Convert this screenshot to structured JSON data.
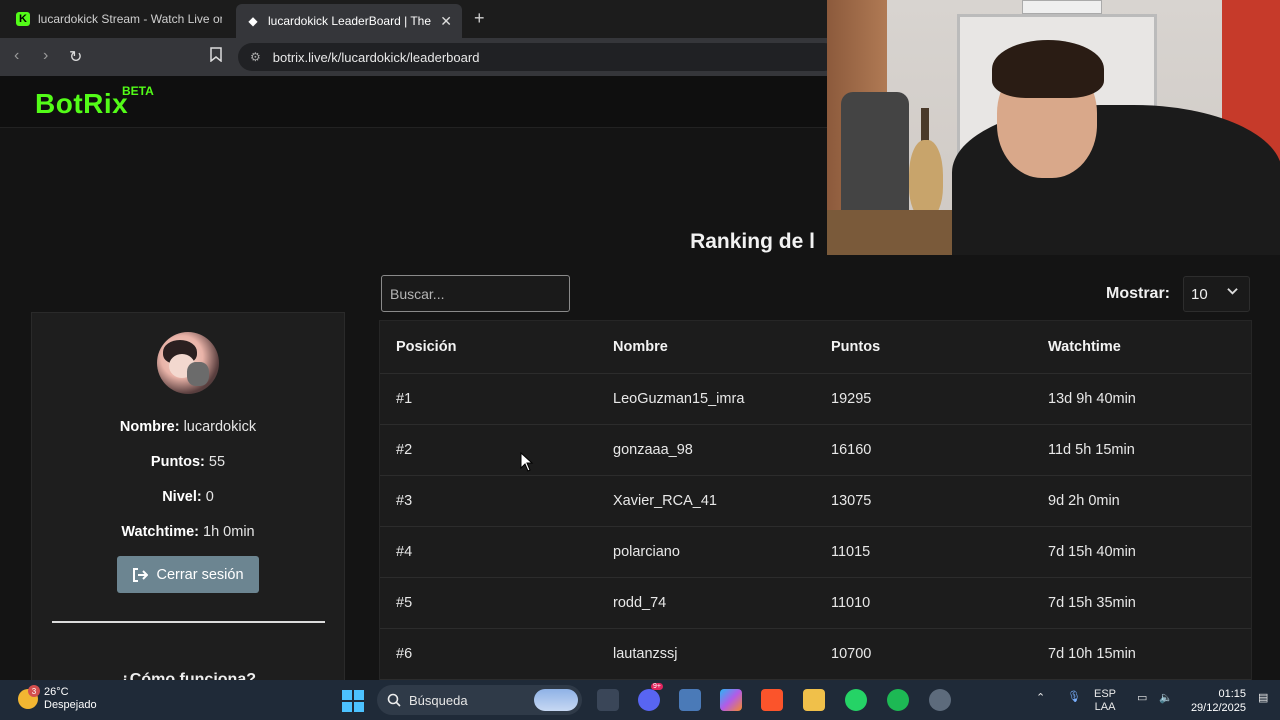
{
  "browser": {
    "tabs": [
      {
        "title": "lucardokick Stream - Watch Live on K",
        "active": false
      },
      {
        "title": "lucardokick LeaderBoard | The b",
        "active": true
      }
    ],
    "url": "botrix.live/k/lucardokick/leaderboard"
  },
  "site": {
    "logo": "BotRix",
    "badge": "BETA",
    "heading": "Ranking de l",
    "accent_color": "#53fc18"
  },
  "profile": {
    "name_label": "Nombre:",
    "name_value": "lucardokick",
    "points_label": "Puntos:",
    "points_value": "55",
    "level_label": "Nivel:",
    "level_value": "0",
    "watchtime_label": "Watchtime:",
    "watchtime_value": "1h 0min",
    "logout_label": "Cerrar sesión",
    "how_heading": "¿Cómo funciona?"
  },
  "controls": {
    "search_placeholder": "Buscar...",
    "show_label": "Mostrar:",
    "show_value": "10"
  },
  "table": {
    "headers": [
      "Posición",
      "Nombre",
      "Puntos",
      "Watchtime"
    ],
    "rows": [
      [
        "#1",
        "LeoGuzman15_imra",
        "19295",
        "13d 9h 40min"
      ],
      [
        "#2",
        "gonzaaa_98",
        "16160",
        "11d 5h 15min"
      ],
      [
        "#3",
        "Xavier_RCA_41",
        "13075",
        "9d 2h 0min"
      ],
      [
        "#4",
        "polarciano",
        "11015",
        "7d 15h 40min"
      ],
      [
        "#5",
        "rodd_74",
        "11010",
        "7d 15h 35min"
      ],
      [
        "#6",
        "lautanzssj",
        "10700",
        "7d 10h 15min"
      ]
    ]
  },
  "taskbar": {
    "weather_temp": "26°C",
    "weather_desc": "Despejado",
    "weather_badge": "3",
    "search_label": "Búsqueda",
    "lang_top": "ESP",
    "lang_bottom": "LAA",
    "time": "01:15",
    "date": "29/12/2025",
    "discord_badge": "9+"
  }
}
